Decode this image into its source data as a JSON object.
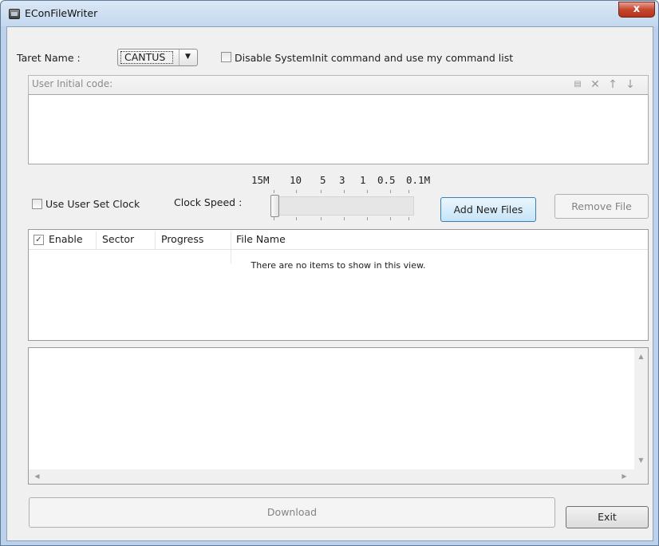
{
  "window": {
    "title": "EConFileWriter",
    "close_label": "x"
  },
  "target": {
    "label": "Taret Name :",
    "value": "CANTUS",
    "disable_checkbox_label": "Disable SystemInit command and use my command list",
    "disable_checked": false
  },
  "user_code": {
    "label": "User Initial code:",
    "toolbar_icons": [
      "new-entry-icon",
      "delete-icon",
      "move-up-icon",
      "move-down-icon"
    ],
    "value": ""
  },
  "clock": {
    "scale_labels": [
      "15M",
      "10",
      "5",
      "3",
      "1",
      "0.5",
      "0.1M"
    ],
    "use_user_clock_label": "Use User Set Clock",
    "use_user_clock_checked": false,
    "speed_label": "Clock Speed :",
    "speed_selected_index": 0
  },
  "buttons": {
    "add_new_files": "Add New Files",
    "remove_file": "Remove File",
    "download": "Download",
    "exit": "Exit"
  },
  "file_list": {
    "columns": [
      "Enable",
      "Sector",
      "Progress",
      "File Name"
    ],
    "enable_header_checked": true,
    "empty_message": "There are no items to show in this view.",
    "rows": []
  },
  "log": {
    "text": ""
  },
  "colors": {
    "accent_button_border": "#3c7fb1",
    "close_button": "#c5472e",
    "window_frame": "#bcd2ea"
  }
}
